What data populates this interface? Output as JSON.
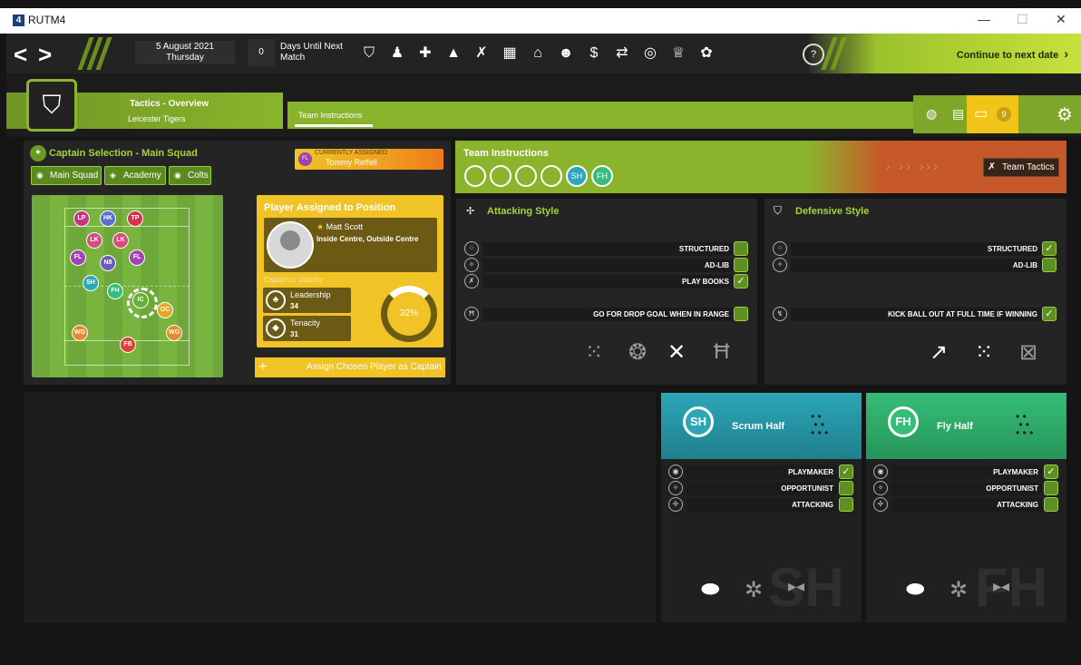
{
  "window": {
    "app_badge": "4",
    "title": "RUTM4",
    "minimize": "—",
    "maximize": "☐",
    "close": "✕"
  },
  "topbar": {
    "date": "5 August 2021",
    "day": "Thursday",
    "days_count": "0",
    "days_label": "Days Until Next Match",
    "help": "?",
    "continue_label": "Continue to next date",
    "nav_icons": [
      "squad-badge-icon",
      "players-icon",
      "medical-icon",
      "training-cone-icon",
      "tactics-icon",
      "calendar-icon",
      "home-icon",
      "staff-icon",
      "finances-icon",
      "transfers-icon",
      "scouting-icon",
      "trophy-icon",
      "team-icon"
    ]
  },
  "header": {
    "title": "Tactics - Overview",
    "team": "Leicester Tigers",
    "tab": "Team Instructions",
    "inbox_count": "9"
  },
  "captain": {
    "title": "Captain Selection - Main Squad",
    "assigned_label": "CURRENTLY ASSIGNED",
    "assigned_initials": "FL",
    "assigned_name": "Tommy Reffell",
    "filters": [
      "Main Squad",
      "Academy",
      "Colts"
    ],
    "players": [
      "LP",
      "HK",
      "TP",
      "LK",
      "LK",
      "FL",
      "N8",
      "FL",
      "SH",
      "FH",
      "IC",
      "OC",
      "WG",
      "WG",
      "FB"
    ]
  },
  "position_panel": {
    "title": "Player Assigned to Position",
    "player": "Matt Scott",
    "positions": "Inside Centre, Outside Centre",
    "viability_label": "Captaincy Viability",
    "leadership_label": "Leadership",
    "leadership_value": "34",
    "tenacity_label": "Tenacity",
    "tenacity_value": "31",
    "viability_pct": "32%",
    "assign_button": "Assign Chosen Player as Captain"
  },
  "team_instructions": {
    "title": "Team Instructions",
    "icons": [
      "",
      "",
      "",
      "",
      "SH",
      "FH"
    ],
    "team_tactics": "Team Tactics"
  },
  "attacking": {
    "title": "Attacking Style",
    "rows": [
      {
        "label": "STRUCTURED",
        "checked": false
      },
      {
        "label": "AD-LIB",
        "checked": false
      },
      {
        "label": "PLAY BOOKS",
        "checked": true
      }
    ],
    "drop_goal": {
      "label": "GO FOR DROP GOAL WHEN IN RANGE",
      "checked": false
    }
  },
  "defensive": {
    "title": "Defensive Style",
    "rows": [
      {
        "label": "STRUCTURED",
        "checked": true
      },
      {
        "label": "AD-LIB",
        "checked": false
      }
    ],
    "kick_out": {
      "label": "KICK BALL OUT AT FULL TIME IF WINNING",
      "checked": true
    }
  },
  "scrum_half": {
    "abbr": "SH",
    "name": "Scrum Half",
    "color": "#2ba7b8",
    "rows": [
      {
        "label": "PLAYMAKER",
        "checked": true
      },
      {
        "label": "OPPORTUNIST",
        "checked": false
      },
      {
        "label": "ATTACKING",
        "checked": false
      }
    ]
  },
  "fly_half": {
    "abbr": "FH",
    "name": "Fly Half",
    "color": "#36bd78",
    "rows": [
      {
        "label": "PLAYMAKER",
        "checked": true
      },
      {
        "label": "OPPORTUNIST",
        "checked": false
      },
      {
        "label": "ATTACKING",
        "checked": false
      }
    ]
  }
}
